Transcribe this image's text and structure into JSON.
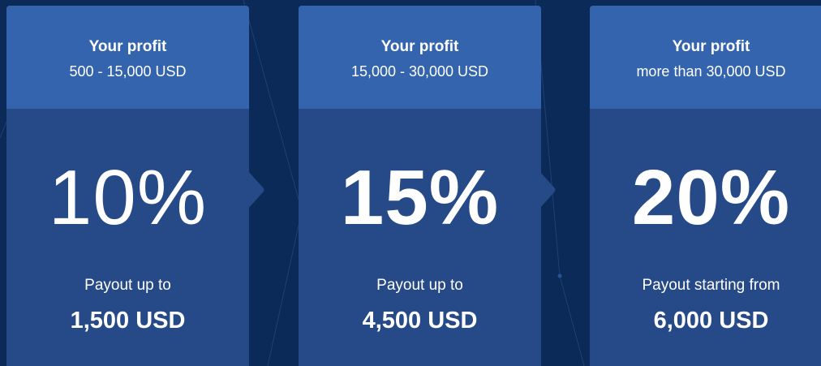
{
  "colors": {
    "background": "#0b2a57",
    "card_body": "#264a88",
    "card_header": "#3464ad",
    "text": "#ffffff"
  },
  "tiers": [
    {
      "header_title": "Your profit",
      "header_range": "500 - 15,000 USD",
      "percent": "10%",
      "payout_label": "Payout up to",
      "payout_value": "1,500 USD"
    },
    {
      "header_title": "Your profit",
      "header_range": "15,000 - 30,000 USD",
      "percent": "15%",
      "payout_label": "Payout up to",
      "payout_value": "4,500 USD"
    },
    {
      "header_title": "Your profit",
      "header_range": "more than 30,000 USD",
      "percent": "20%",
      "payout_label": "Payout starting from",
      "payout_value": "6,000 USD"
    }
  ]
}
